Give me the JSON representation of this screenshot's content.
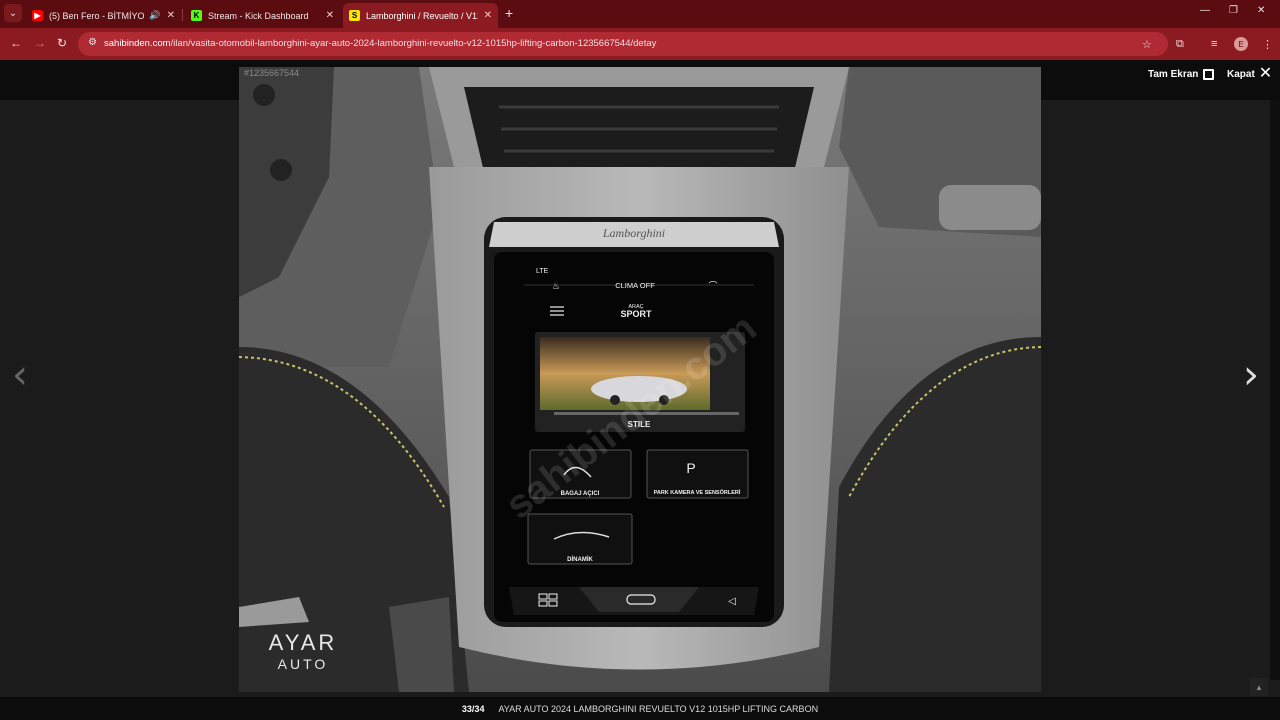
{
  "browser": {
    "tabs": [
      {
        "title": "(5) Ben Fero - BİTMİYOR - Y",
        "favicon_color": "#ff0000"
      },
      {
        "title": "Stream - Kick Dashboard",
        "favicon_color": "#53fc18"
      },
      {
        "title": "Lamborghini / Revuelto / V12 /",
        "favicon_color": "#ffe800"
      }
    ],
    "url_domain": "sahibinden.com",
    "url_path": "/ilan/vasita-otomobil-lamborghini-ayar-auto-2024-lamborghini-revuelto-v12-1015hp-lifting-carbon-1235667544/detay",
    "profile_initial": "E"
  },
  "lightbox": {
    "photo_id": "#1235667544",
    "fullscreen_label": "Tam Ekran",
    "close_label": "Kapat",
    "counter": "33/34",
    "caption": "AYAR AUTO 2024 LAMBORGHINI REVUELTO V12 1015HP LIFTING CARBON"
  },
  "photo": {
    "logo_line1": "AYAR",
    "logo_line2": "AUTO",
    "watermark": "sahibinden.com",
    "screen": {
      "status": "LTE",
      "clima": "CLIMA OFF",
      "mode_label": "ARAÇ",
      "mode_value": "SPORT",
      "stile": "STILE",
      "bagaj": "BAGAJ AÇICI",
      "park": "PARK KAMERA VE SENSÖRLERİ",
      "dinamik": "DİNAMİK"
    }
  }
}
